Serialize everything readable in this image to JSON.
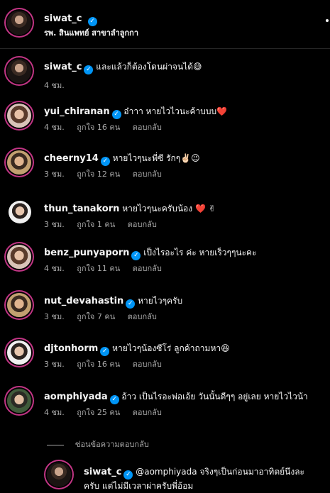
{
  "header": {
    "username": "siwat_c",
    "location": "รพ. สินแพทย์ สาขาลำลูกกา"
  },
  "comments": [
    {
      "username": "siwat_c",
      "verified": true,
      "text": "และแล้วก็ต้องโดนผ่าจนได้😅",
      "time": "4 ชม.",
      "likes": "",
      "reply": ""
    },
    {
      "username": "yui_chiranan",
      "verified": true,
      "text": "อ๋าาา หายไวไวนะค้าบบบ❤️",
      "time": "4 ชม.",
      "likes": "ถูกใจ 16 คน",
      "reply": "ตอบกลับ"
    },
    {
      "username": "cheerny14",
      "verified": true,
      "text": "หายไวๆนะพี่ซี รักๆ✌🏻😉",
      "time": "3 ชม.",
      "likes": "ถูกใจ 12 คน",
      "reply": "ตอบกลับ"
    },
    {
      "username": "thun_tanakorn",
      "verified": false,
      "text": "หายไวๆนะครับน้อง ❤️ ✌",
      "time": "3 ชม.",
      "likes": "ถูกใจ 1 คน",
      "reply": "ตอบกลับ"
    },
    {
      "username": "benz_punyaporn",
      "verified": true,
      "text": "เป็งไรอะไร ค่ะ หายเร็วๆๆนะคะ",
      "time": "4 ชม.",
      "likes": "ถูกใจ 11 คน",
      "reply": "ตอบกลับ"
    },
    {
      "username": "nut_devahastin",
      "verified": true,
      "text": "หายไวๆครับ",
      "time": "3 ชม.",
      "likes": "ถูกใจ 7 คน",
      "reply": "ตอบกลับ"
    },
    {
      "username": "djtonhorm",
      "verified": true,
      "text": "หายไวๆน้องซีโร่ ลูกค้าถามหา😆",
      "time": "3 ชม.",
      "likes": "ถูกใจ 16 คน",
      "reply": "ตอบกลับ"
    },
    {
      "username": "aomphiyada",
      "verified": true,
      "text": "อ้าว เป็นไรอะพ่อเอ้ย วันนั้นดีๆๆ อยู่เลย หายไวไวน้า",
      "time": "4 ชม.",
      "likes": "ถูกใจ 25 คน",
      "reply": "ตอบกลับ"
    }
  ],
  "hidden_replies_label": "ซ่อนข้อความตอบกลับ",
  "reply": {
    "username": "siwat_c",
    "mention": "@aomphiyada",
    "text_line1": "จริงๆเป็นก่อนมาอาทิตย์นึงละ",
    "text_line2": "ครับ แต่ไม่มีเวลาผ่าครับพี่อ้อม"
  },
  "icons": {
    "verified": "verified-badge-icon",
    "more": "more-options-icon"
  },
  "colors": {
    "background": "#000000",
    "verified": "#0095f6",
    "muted": "#a8a8a8",
    "heart": "#ed4956"
  }
}
